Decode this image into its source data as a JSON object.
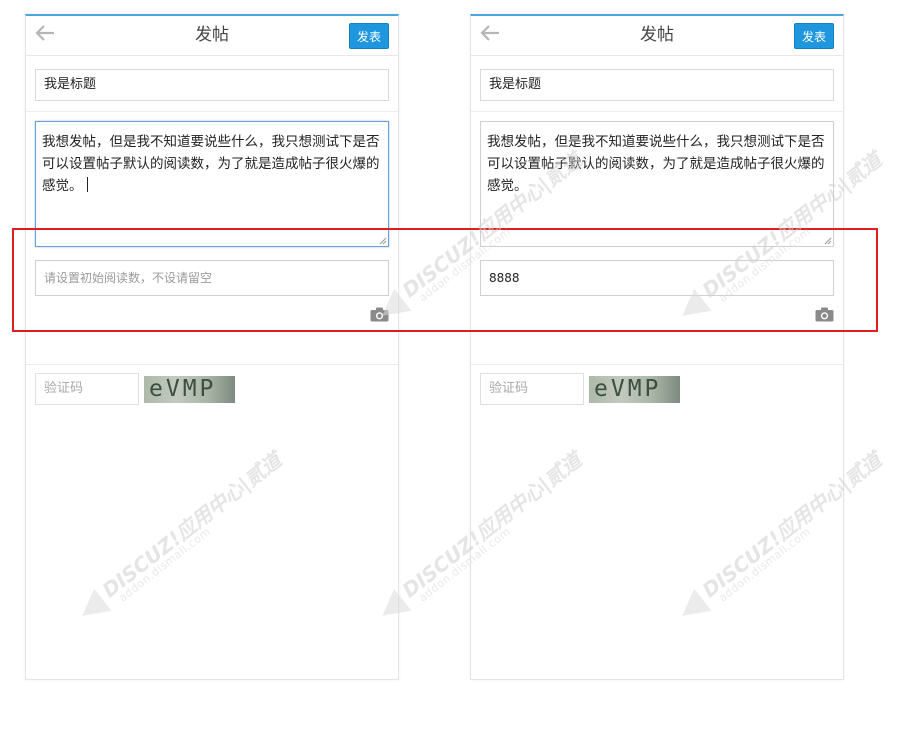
{
  "left_panel": {
    "header": {
      "title": "发帖",
      "publish_label": "发表"
    },
    "form": {
      "subject_value": "我是标题",
      "message_value": "我想发帖，但是我不知道要说些什么，我只想测试下是否可以设置帖子默认的阅读数，为了就是造成帖子很火爆的感觉。",
      "readcount_placeholder": "请设置初始阅读数，不设请留空",
      "readcount_value": "",
      "captcha_placeholder": "验证码",
      "captcha_text": "eVMP"
    }
  },
  "right_panel": {
    "header": {
      "title": "发帖",
      "publish_label": "发表"
    },
    "form": {
      "subject_value": "我是标题",
      "message_value": "我想发帖，但是我不知道要说些什么，我只想测试下是否可以设置帖子默认的阅读数，为了就是造成帖子很火爆的感觉。",
      "readcount_placeholder": "请设置初始阅读数，不设请留空",
      "readcount_value": "8888",
      "captcha_placeholder": "验证码",
      "captcha_text": "eVMP"
    }
  },
  "watermark": {
    "brand": "DISCUZ!应用中心|贰道",
    "domain": "addon.dismall.com"
  },
  "icons": {
    "back": "arrow-left-icon",
    "camera": "camera-icon"
  },
  "colors": {
    "accent": "#1f97de",
    "highlight": "#e01e1e",
    "header_top_border": "#4aa6dd"
  }
}
